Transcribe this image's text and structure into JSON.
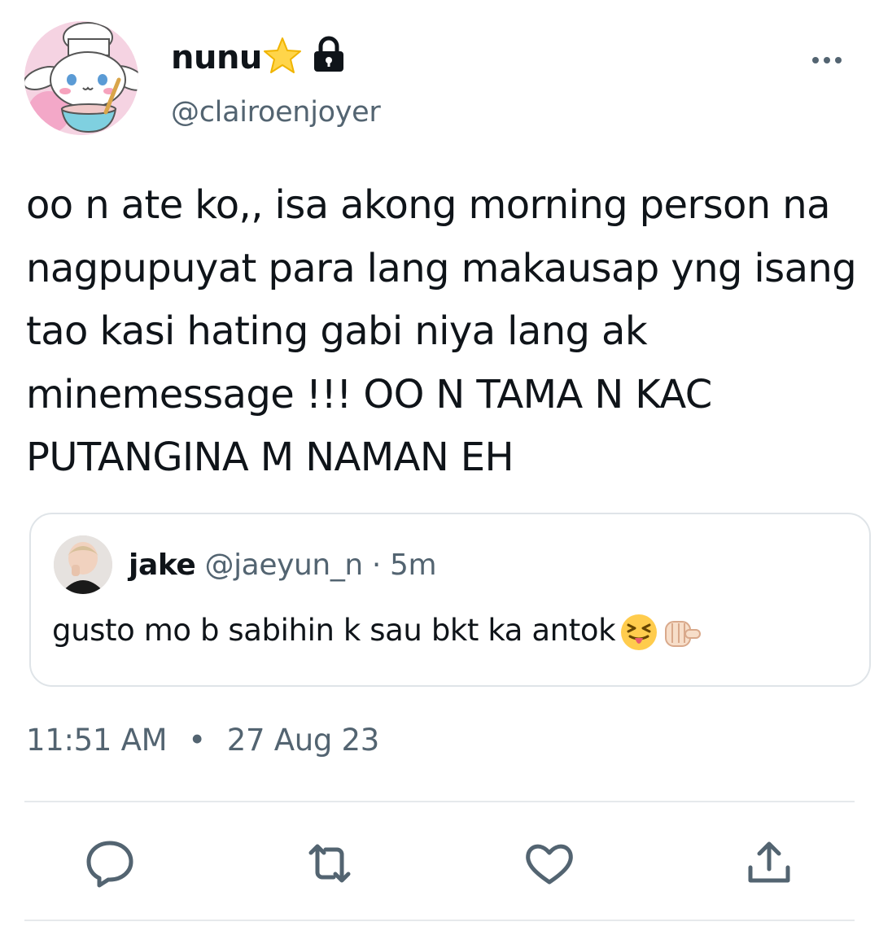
{
  "author": {
    "name": "nunu",
    "handle": "@clairoenjoyer",
    "badge_icon": "star-icon",
    "protected_icon": "lock-icon"
  },
  "tweet": {
    "text": "oo n ate ko,, isa akong morning person na nagpupuyat para lang makausap yng isang tao kasi hating gabi niya lang ak minemessage !!! OO N TAMA N KAC PUTANGINA M NAMAN EH"
  },
  "quoted": {
    "name": "jake",
    "handle": "@jaeyun_n",
    "separator": "·",
    "time": "5m",
    "text": "gusto mo b sabihin k sau bkt ka antok",
    "emojis": [
      "squinting-tongue-face-icon",
      "pointing-fist-icon"
    ]
  },
  "meta": {
    "time": "11:51 AM",
    "separator": "•",
    "date": "27 Aug 23"
  },
  "actions": [
    "reply-icon",
    "retweet-icon",
    "like-icon",
    "share-icon"
  ],
  "colors": {
    "text_primary": "#0f1419",
    "text_secondary": "#536471",
    "border": "#dfe4e8",
    "icon": "#536471"
  }
}
